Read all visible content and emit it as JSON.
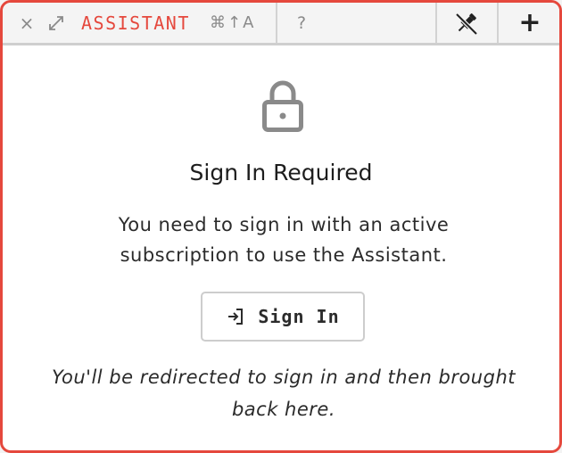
{
  "toolbar": {
    "close_glyph": "×",
    "title": "ASSISTANT",
    "shortcut": "⌘↑A",
    "help_glyph": "?",
    "new_glyph": "+"
  },
  "icons": {
    "close": "close-icon",
    "expand": "expand-icon",
    "help": "help-icon",
    "pin": "unpin-icon",
    "add": "plus-icon",
    "lock": "lock-icon",
    "sign_in": "sign-in-icon"
  },
  "main": {
    "heading": "Sign In Required",
    "message": "You need to sign in with an active subscription to use the Assistant.",
    "button_label": "Sign In",
    "note": "You'll be redirected to sign in and then brought back here."
  },
  "colors": {
    "accent": "#e5483d",
    "toolbar_bg": "#f4f4f4",
    "icon_gray": "#8a8a8a",
    "text": "#2b2b2b"
  }
}
